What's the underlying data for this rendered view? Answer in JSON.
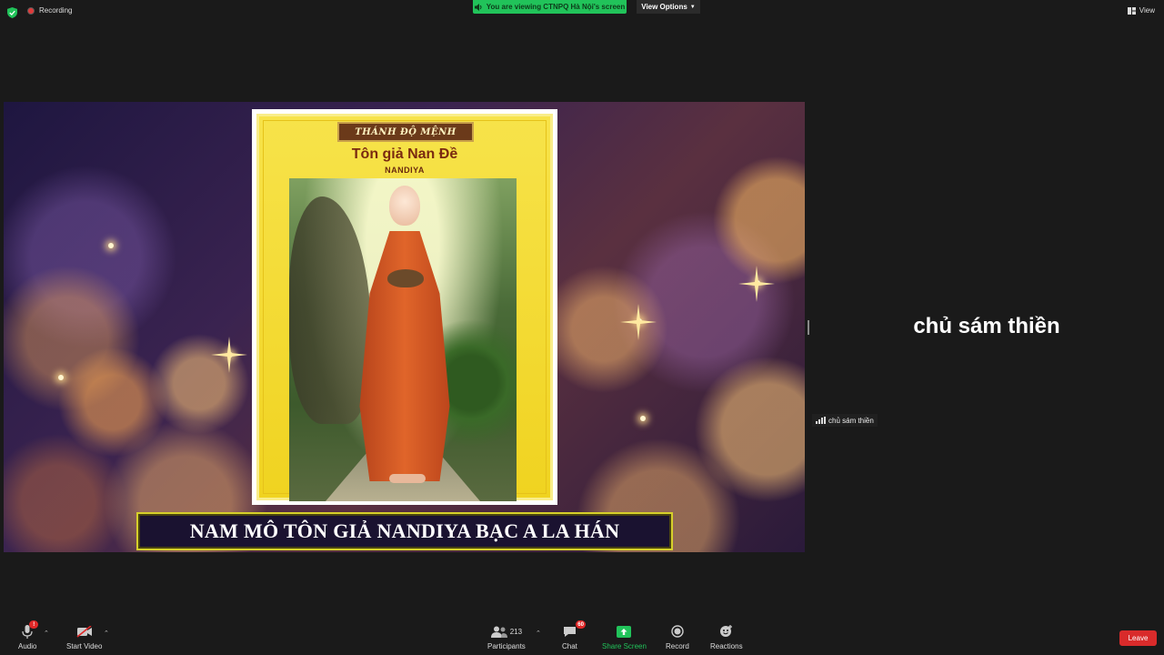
{
  "topbar": {
    "recording_label": "Recording",
    "banner_text": "You are viewing CTNPQ Hà Nội's screen",
    "view_options_label": "View Options",
    "view_label": "View"
  },
  "shared_screen": {
    "card": {
      "plaque_text": "THÁNH ĐỘ MỆNH",
      "title": "Tôn giả Nan Đề",
      "subtitle": "NANDIYA"
    },
    "caption": "NAM MÔ TÔN GIẢ NANDIYA BẠC A LA HÁN"
  },
  "gallery": {
    "participant_name_large": "chủ sám thiền",
    "participant_name_tag": "chủ sám thiền"
  },
  "toolbar": {
    "audio_label": "Audio",
    "audio_badge": "!",
    "start_video_label": "Start Video",
    "participants_label": "Participants",
    "participants_count": "213",
    "chat_label": "Chat",
    "chat_badge": "60",
    "share_screen_label": "Share Screen",
    "record_label": "Record",
    "reactions_label": "Reactions",
    "leave_label": "Leave"
  },
  "colors": {
    "banner_green": "#21c35a",
    "leave_red": "#d92b2b",
    "background": "#1a1a1a",
    "caption_border": "#d6d02a"
  },
  "icons": [
    "shield-icon",
    "recording-dot-icon",
    "speaker-icon",
    "chevron-down-icon",
    "view-grid-icon",
    "mic-icon",
    "video-off-icon",
    "participants-icon",
    "chat-icon",
    "share-screen-icon",
    "record-icon",
    "reactions-icon",
    "signal-bars-icon"
  ]
}
